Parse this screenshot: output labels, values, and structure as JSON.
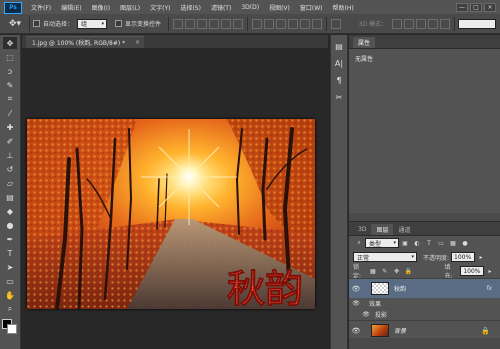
{
  "app": {
    "logo": "Ps"
  },
  "menu": [
    "文件(F)",
    "编辑(E)",
    "图像(I)",
    "图层(L)",
    "文字(Y)",
    "选择(S)",
    "滤镜(T)",
    "3D(D)",
    "视图(V)",
    "窗口(W)",
    "帮助(H)"
  ],
  "window_controls": {
    "minimize": "—",
    "maximize": "□",
    "close": "×"
  },
  "options_bar": {
    "auto_select_label": "自动选择：",
    "auto_select_value": "组",
    "show_transform_label": "显示变换控件",
    "mode_3d_label": "3D 模式："
  },
  "document": {
    "tab_title": "1.jpg @ 100% (秋韵, RGB/8#) *",
    "close": "×",
    "overlay_text": "秋韵"
  },
  "properties_panel": {
    "tab_label": "属性",
    "empty_text": "无属性"
  },
  "layers_panel": {
    "tabs": [
      "3D",
      "图层",
      "通道"
    ],
    "filter_kind": "类型",
    "blend_mode": "正常",
    "opacity_label": "不透明度:",
    "opacity_value": "100%",
    "lock_label": "锁定:",
    "fill_label": "填充:",
    "fill_value": "100%",
    "layers": [
      {
        "name": "秋韵",
        "fx": "fx",
        "effects_label": "效果",
        "effects": [
          "投影"
        ]
      },
      {
        "name": "背景"
      }
    ]
  },
  "colors": {
    "accent": "#596c84",
    "text_red": "#e8402a"
  }
}
